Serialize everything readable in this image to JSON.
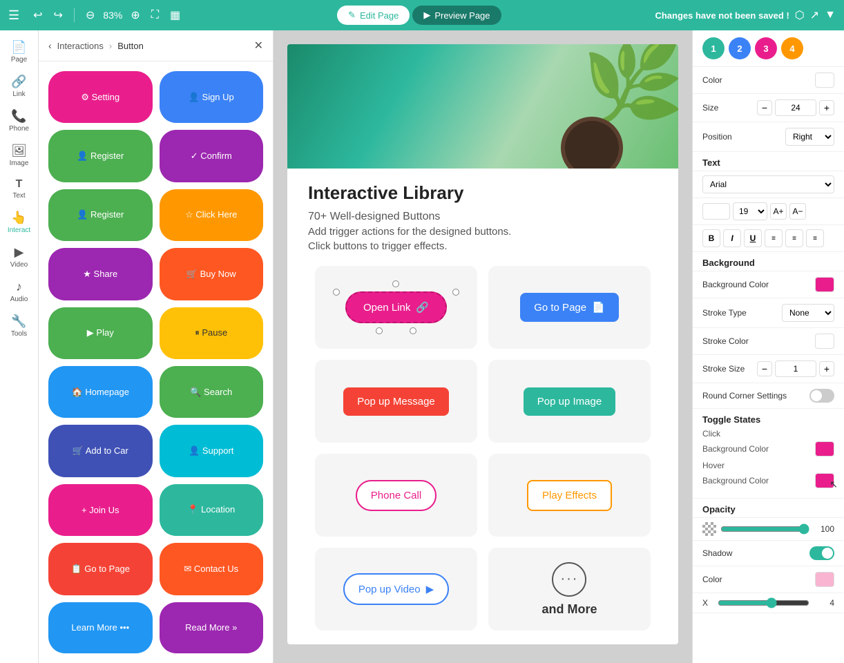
{
  "topbar": {
    "menu_icon": "☰",
    "undo_icon": "↩",
    "redo_icon": "↪",
    "zoom_icon": "⊖",
    "zoom_level": "83%",
    "zoom_in_icon": "⊕",
    "fullscreen_icon": "⛶",
    "settings_icon": "⚙",
    "edit_page_label": "Edit Page",
    "preview_page_label": "Preview Page",
    "unsaved_message": "Changes have not been saved !",
    "export_icon": "⬡",
    "share_icon": "↗",
    "more_icon": "▼"
  },
  "sidebar": {
    "items": [
      {
        "label": "Page",
        "icon": "📄"
      },
      {
        "label": "Link",
        "icon": "🔗"
      },
      {
        "label": "Phone",
        "icon": "📞"
      },
      {
        "label": "Image",
        "icon": "🖼"
      },
      {
        "label": "Text",
        "icon": "T"
      },
      {
        "label": "Interact",
        "icon": "👆"
      },
      {
        "label": "Video",
        "icon": "▶"
      },
      {
        "label": "Audio",
        "icon": "♪"
      },
      {
        "label": "Tools",
        "icon": "🔧"
      }
    ]
  },
  "panel": {
    "breadcrumb_back": "Interactions",
    "breadcrumb_current": "Button",
    "buttons": [
      {
        "label": "Setting",
        "icon": "⚙",
        "style": "btn-pink"
      },
      {
        "label": "Sign Up",
        "icon": "👤",
        "style": "btn-blue"
      },
      {
        "label": "Register",
        "icon": "👤",
        "style": "btn-green-reg"
      },
      {
        "label": "Confirm",
        "icon": "✓",
        "style": "btn-purple-confirm"
      },
      {
        "label": "Register",
        "icon": "👤",
        "style": "btn-green-reg2"
      },
      {
        "label": "Click Here",
        "icon": "☆",
        "style": "btn-orange"
      },
      {
        "label": "Share",
        "icon": "★",
        "style": "btn-purple"
      },
      {
        "label": "Buy Now",
        "icon": "🛒",
        "style": "btn-orange2"
      },
      {
        "label": "Play",
        "icon": "▶",
        "style": "btn-green-play"
      },
      {
        "label": "Pause",
        "icon": "⏸",
        "style": "btn-amber"
      },
      {
        "label": "Homepage",
        "icon": "🏠",
        "style": "btn-blue-home"
      },
      {
        "label": "Search",
        "icon": "🔍",
        "style": "btn-green-search"
      },
      {
        "label": "Add to Car",
        "icon": "🛒",
        "style": "btn-indigo"
      },
      {
        "label": "Support",
        "icon": "👤",
        "style": "btn-cyan"
      },
      {
        "label": "Join Us",
        "icon": "+",
        "style": "btn-pink2"
      },
      {
        "label": "Location",
        "icon": "📍",
        "style": "btn-green-join"
      },
      {
        "label": "Go to Page",
        "icon": "📋",
        "style": "btn-red"
      },
      {
        "label": "Contact Us",
        "icon": "✉",
        "style": "btn-orange3"
      },
      {
        "label": "Learn More",
        "icon": "•••",
        "style": "btn-blue2"
      },
      {
        "label": "Read More",
        "icon": "»",
        "style": "btn-purple2"
      }
    ]
  },
  "canvas": {
    "title": "Interactive Library",
    "subtitle1": "70+ Well-designed Buttons",
    "subtitle2": "Add trigger actions for the designed buttons.",
    "subtitle3": "Click buttons to trigger effects.",
    "buttons": {
      "open_link": "Open Link",
      "goto_page": "Go to Page",
      "popup_message": "Pop up Message",
      "popup_image": "Pop up Image",
      "phone_call": "Phone Call",
      "play_effects": "Play Effects",
      "popup_video": "Pop up Video",
      "and_more": "and More"
    }
  },
  "right_panel": {
    "avatars": [
      {
        "color": "#2db89e",
        "label": "1"
      },
      {
        "color": "#3b82f6",
        "label": "2"
      },
      {
        "color": "#e91e8c",
        "label": "3"
      },
      {
        "color": "#ff9800",
        "label": "4"
      }
    ],
    "color_label": "Color",
    "size_label": "Size",
    "size_value": "24",
    "position_label": "Position",
    "position_value": "Right",
    "text_section": "Text",
    "font_family": "Arial",
    "font_size": "19",
    "background_section": "Background",
    "background_color_label": "Background Color",
    "stroke_type_label": "Stroke Type",
    "stroke_type_value": "None",
    "stroke_color_label": "Stroke Color",
    "stroke_size_label": "Stroke Size",
    "stroke_size_value": "1",
    "round_corner_label": "Round Corner Settings",
    "toggle_states_section": "Toggle States",
    "click_label": "Click",
    "click_bg_label": "Background Color",
    "hover_label": "Hover",
    "hover_bg_label": "Background Color",
    "opacity_label": "Opacity",
    "opacity_value": "100",
    "shadow_label": "Shadow",
    "shadow_color_label": "Color",
    "shadow_x_label": "X",
    "shadow_x_value": "4",
    "background_color_hex": "#e91e8c",
    "click_bg_color_hex": "#e91e8c",
    "hover_bg_color_hex": "#e91e8c",
    "shadow_color_hex": "#f8b4d0"
  }
}
